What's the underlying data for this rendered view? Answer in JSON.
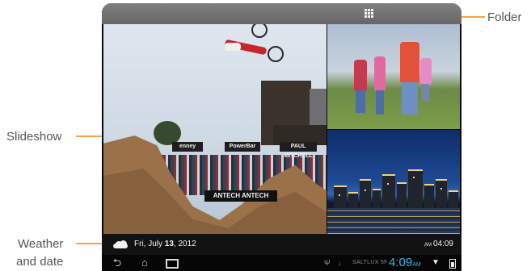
{
  "callouts": {
    "folder": "Folder",
    "slideshow": "Slideshow",
    "weather_line1": "Weather",
    "weather_line2": "and date"
  },
  "slideshow": {
    "banners": [
      "enney",
      "PowerBar",
      "PAUL MITCHELL",
      "ANTECH  ANTECH"
    ]
  },
  "infobar": {
    "date_weekday": "Fri, July",
    "date_day": "13",
    "date_year": ", 2012",
    "clock_ampm": "AM",
    "clock_time": "04:09"
  },
  "statusbar": {
    "carrier": "SALTLUX 5F",
    "time": "4:09",
    "ampm": "AM"
  },
  "icons": [
    "grid-icon",
    "cloud-icon",
    "back-icon",
    "home-icon",
    "recent-apps-icon",
    "usb-icon",
    "mic-icon",
    "wifi-icon",
    "battery-icon"
  ],
  "colors": {
    "accent": "#f5a142",
    "clock_blue": "#39b6e8"
  }
}
